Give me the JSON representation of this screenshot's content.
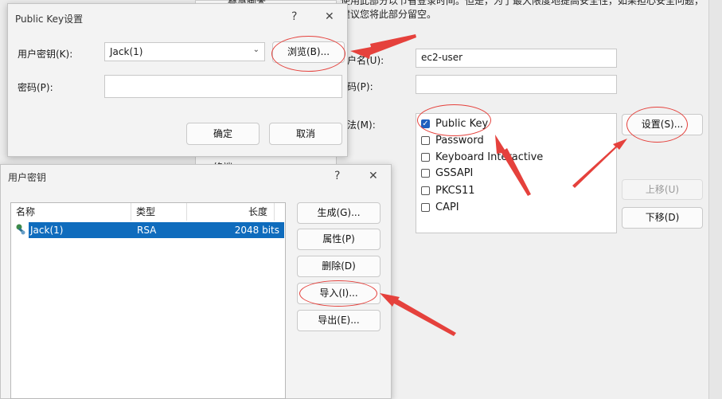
{
  "background": {
    "notice_line1": "使用此部分以节省登录时间。但是，为了最大限度地提高安全性，如果担心安全问题，",
    "notice_line2": "建议您将此部分留空。",
    "tree_item_top": "登录脚本",
    "tree_item_bottom": "终端",
    "username_label": "用户名(U):",
    "username_value": "ec2-user",
    "password_label": "密码(P):",
    "method_label": "方法(M):",
    "methods": [
      {
        "label": "Public Key",
        "checked": true
      },
      {
        "label": "Password",
        "checked": false
      },
      {
        "label": "Keyboard Interactive",
        "checked": false
      },
      {
        "label": "GSSAPI",
        "checked": false
      },
      {
        "label": "PKCS11",
        "checked": false
      },
      {
        "label": "CAPI",
        "checked": false
      }
    ],
    "settings_button": "设置(S)...",
    "move_up_button": "上移(U)",
    "move_down_button": "下移(D)"
  },
  "pubkey_dialog": {
    "title": "Public Key设置",
    "help": "?",
    "close": "✕",
    "user_key_label": "用户密钥(K):",
    "user_key_value": "Jack(1)",
    "browse_button": "浏览(B)...",
    "passphrase_label": "密码(P):",
    "ok_button": "确定",
    "cancel_button": "取消"
  },
  "userkey_dialog": {
    "title": "用户密钥",
    "help": "?",
    "close": "✕",
    "columns": [
      "名称",
      "类型",
      "长度"
    ],
    "rows": [
      {
        "name": "Jack(1)",
        "type": "RSA",
        "length": "2048 bits"
      }
    ],
    "buttons": {
      "generate": "生成(G)...",
      "properties": "属性(P)",
      "delete": "删除(D)",
      "import": "导入(I)...",
      "export": "导出(E)..."
    }
  },
  "colors": {
    "annotation": "#e5413c",
    "selection": "#0f6cbd"
  }
}
